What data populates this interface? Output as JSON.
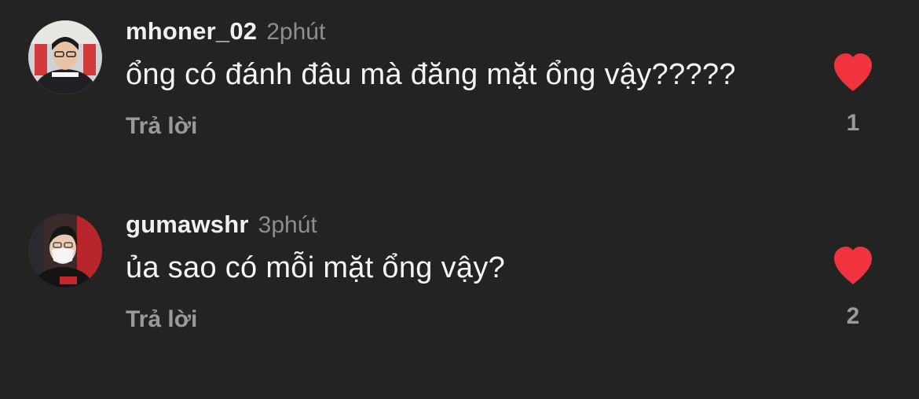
{
  "comments": [
    {
      "username": "mhoner_02",
      "time": "2phút",
      "text": "ổng có đánh đâu mà đăng mặt ổng vậy?????",
      "reply_label": "Trả lời",
      "like_count": "1",
      "liked": true
    },
    {
      "username": "gumawshr",
      "time": "3phút",
      "text": "ủa sao có mỗi mặt ổng vậy?",
      "reply_label": "Trả lời",
      "like_count": "2",
      "liked": true
    }
  ],
  "colors": {
    "background": "#232323",
    "heart": "#f0333f",
    "muted_text": "#8e8e8e"
  },
  "icons": {
    "like": "heart-icon"
  }
}
